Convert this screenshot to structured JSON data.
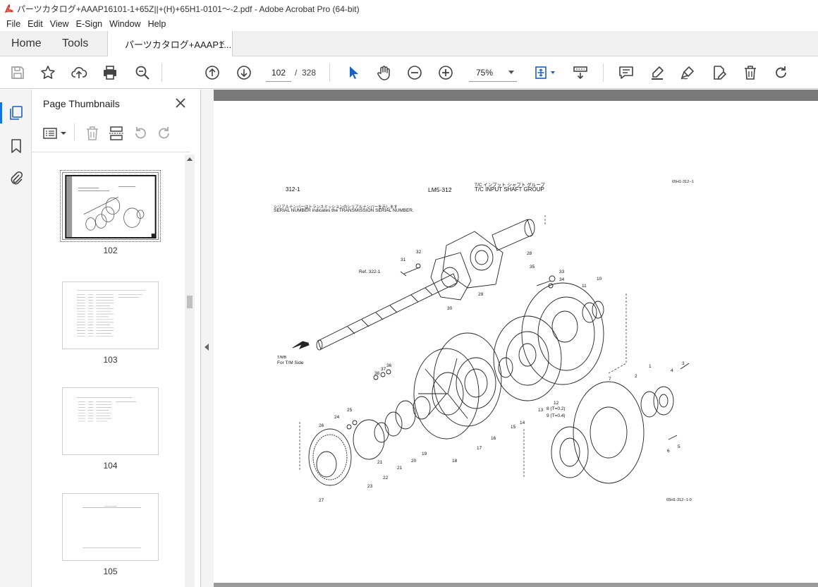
{
  "window": {
    "title": "パーツカタログ+AAAP16101-1+65Z||+(H)+65H1-0101～-2.pdf - Adobe Acrobat Pro (64-bit)"
  },
  "menu": [
    "File",
    "Edit",
    "View",
    "E-Sign",
    "Window",
    "Help"
  ],
  "tabs": {
    "home": "Home",
    "tools": "Tools",
    "document": "パーツカタログ+AAAP1...",
    "close_glyph": "×"
  },
  "toolbar": {
    "page_current": "102",
    "page_separator": "/",
    "page_total": "328",
    "zoom": "75%"
  },
  "thumbnails_panel": {
    "title": "Page Thumbnails",
    "pages": [
      {
        "label": "102",
        "selected": true
      },
      {
        "label": "103",
        "selected": false
      },
      {
        "label": "104",
        "selected": false
      },
      {
        "label": "105",
        "selected": false
      }
    ]
  },
  "document": {
    "page_number": "312-1",
    "model_code": "LM5-312",
    "title_jp": "T/C インプット シャフト グループ",
    "title_en": "T/C INPUT SHAFT GROUP",
    "ref_top": "65H1-312--1",
    "note_jp": "シリアルナンバーはトランスミッションのシリアルナンバーを示します",
    "note_en": "SERIAL NUMBER indicates the TRANSMISSION SERIAL NUMBER.",
    "ref_label": "Ref. 322-1",
    "tm_label_1": "T/MB",
    "tm_label_2": "For T/M Side",
    "shim_1": "8 (T=0.2)",
    "shim_2": "9 (T=0.4)",
    "ref_bottom": "65H1-312--1-0",
    "callouts": [
      "1",
      "2",
      "3",
      "4",
      "5",
      "6",
      "7",
      "10",
      "11",
      "12",
      "13",
      "14",
      "15",
      "16",
      "17",
      "18",
      "19",
      "20",
      "21",
      "21",
      "22",
      "23",
      "24",
      "25",
      "26",
      "27",
      "28",
      "29",
      "30",
      "31",
      "32",
      "33",
      "34",
      "35",
      "36",
      "37",
      "38"
    ]
  }
}
